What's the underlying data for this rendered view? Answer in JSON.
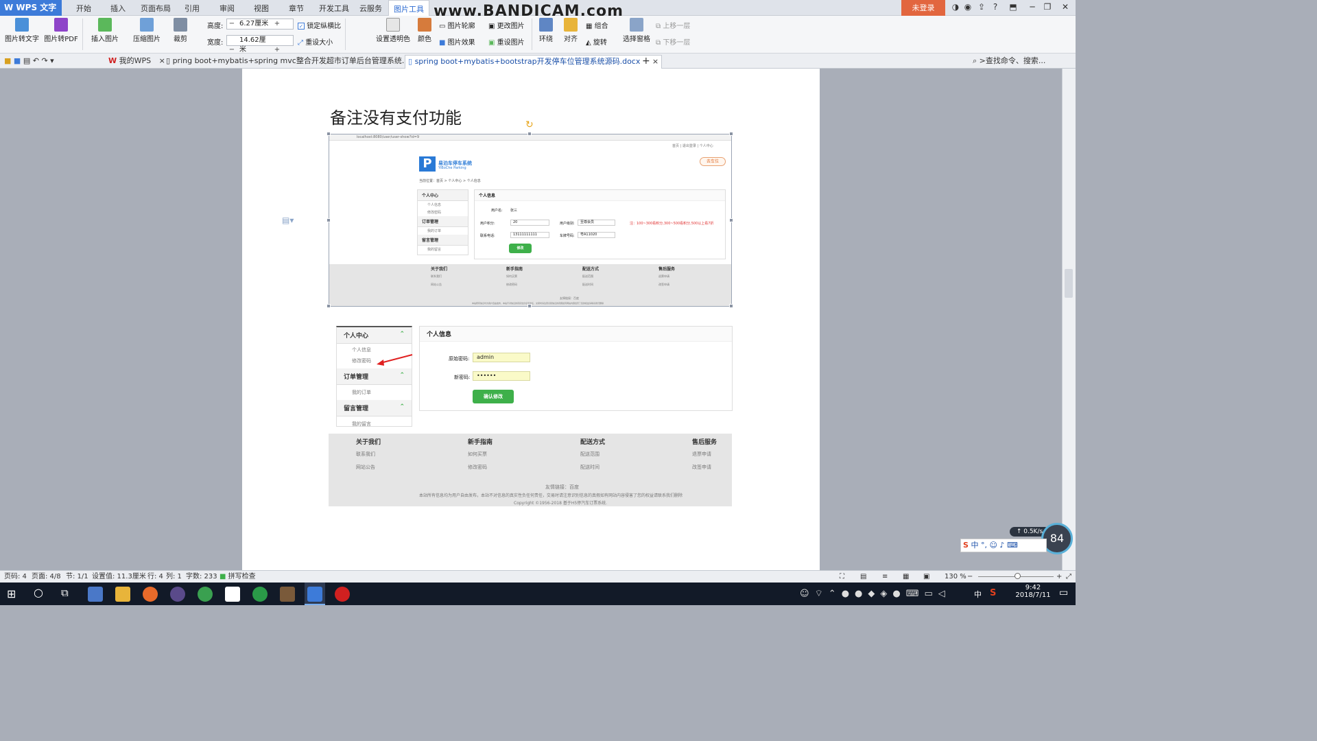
{
  "app": {
    "title": "WPS 文字"
  },
  "menu": {
    "items": [
      "开始",
      "插入",
      "页面布局",
      "引用",
      "审阅",
      "视图",
      "章节",
      "开发工具",
      "云服务",
      "图片工具"
    ],
    "active": "图片工具",
    "login": "未登录",
    "watermark": "www.BANDICAM.com"
  },
  "ribbon": {
    "pic_to_text": "图片转文字",
    "pic_to_pdf": "图片转PDF",
    "insert_pic": "插入图片",
    "compress_pic": "压缩图片",
    "crop": "裁剪",
    "height_label": "高度:",
    "height_value": "6.27厘米",
    "width_label": "宽度:",
    "width_value": "14.62厘米",
    "lock_ratio": "锁定纵横比",
    "reset_size": "重设大小",
    "set_transparent": "设置透明色",
    "color": "颜色",
    "pic_outline": "图片轮廓",
    "pic_effect": "图片效果",
    "change_pic": "更改图片",
    "reset_pic": "重设图片",
    "wrap": "环绕",
    "align": "对齐",
    "group": "组合",
    "rotate": "旋转",
    "select_pane": "选择窗格",
    "bring_forward": "上移一层",
    "send_backward": "下移一层",
    "minus": "−",
    "plus": "+"
  },
  "tabs": {
    "mywps": "我的WPS",
    "doc1": "pring boot+mybatis+spring mvc整合开发超市订单后台管理系统.docx",
    "doc2": "spring boot+mybatis+bootstrap开发停车位管理系统源码.docx",
    "search": ">查找命令、搜索..."
  },
  "document": {
    "heading": "备注没有支付功能"
  },
  "shot1": {
    "url": "localhost:8080/user/user-show?id=9",
    "logo_title": "易泊车停车系统",
    "logo_sub": "YiBoChe Parking",
    "location": "当前位置：首页 > 个人中心 > 个人信息",
    "top_links": "首页 | 退出登录 | 个人中心",
    "orange_btn": "去车位",
    "side": [
      {
        "head": "个人中心",
        "items": [
          "个人信息",
          "修改密码"
        ]
      },
      {
        "head": "订单管理",
        "items": [
          "我的订单"
        ]
      },
      {
        "head": "留言管理",
        "items": [
          "我的留言"
        ]
      }
    ],
    "panel_title": "个人信息",
    "username_label": "用户名:",
    "username": "张三",
    "points_label": "用户积分:",
    "points": "20",
    "level_label": "用户级别:",
    "level": "至尊会员",
    "phone_label": "联系电话:",
    "phone": "13111111111",
    "plate_label": "车牌号码:",
    "plate": "粤A11020",
    "note": "注：100~300看积分,300~500看积分,500以上看7折",
    "btn": "修改",
    "footer_cols": [
      "关于我们",
      "新手指南",
      "配送方式",
      "售后服务"
    ],
    "footer_rows": [
      [
        "联系我们",
        "如何买票",
        "配送范围",
        "退票申请"
      ],
      [
        "网站公告",
        "修改密码",
        "配送时间",
        "改签申请"
      ]
    ],
    "friend": "友情链接：百度",
    "disclaimer": "本站所有信息均为用户自由发布，本站不对信息的真实性负任何责任，交易时请注意识别信息的真假如有网站内容侵害了您的权益请联系我们删除"
  },
  "shot2": {
    "side": [
      {
        "head": "个人中心",
        "items": [
          "个人信息",
          "修改密码"
        ]
      },
      {
        "head": "订单管理",
        "items": [
          "我的订单"
        ]
      },
      {
        "head": "留言管理",
        "items": [
          "我的留言"
        ]
      }
    ],
    "panel_title": "个人信息",
    "old_pwd_label": "原始密码:",
    "old_pwd": "admin",
    "new_pwd_label": "新密码:",
    "new_pwd": "••••••",
    "confirm_btn": "确认修改",
    "footer_cols": [
      "关于我们",
      "新手指南",
      "配送方式",
      "售后服务"
    ],
    "footer_rows": [
      [
        "联系我们",
        "如何买票",
        "配送范围",
        "退票申请"
      ],
      [
        "网站公告",
        "修改密码",
        "配送时间",
        "改签申请"
      ]
    ],
    "friend": "友情链接：百度",
    "disclaimer": "本站所有信息均为用户自由发布，本站不对信息的真实性负任何责任，交易时请注意识别信息的真假如有网站内容侵害了您的权益请联系我们删除",
    "copyright": "Copyright ©1956-2018 基于H5停汽车订票系统."
  },
  "status": {
    "pagenum": "页码: 4",
    "pages": "页面: 4/8",
    "section": "节: 1/1",
    "setting": "设置值: 11.3厘米",
    "row": "行: 4",
    "col": "列: 1",
    "words": "字数: 233",
    "spell": "拼写检查",
    "zoom": "130 %"
  },
  "taskbar": {
    "time": "9:42",
    "date": "2018/7/11",
    "lang": "中",
    "net": "0.5K/s",
    "cpu": "84"
  },
  "colors": {
    "accent": "#3d7bd9",
    "login": "#e2663f",
    "green": "#3eb04a",
    "arrow": "#e02020"
  }
}
